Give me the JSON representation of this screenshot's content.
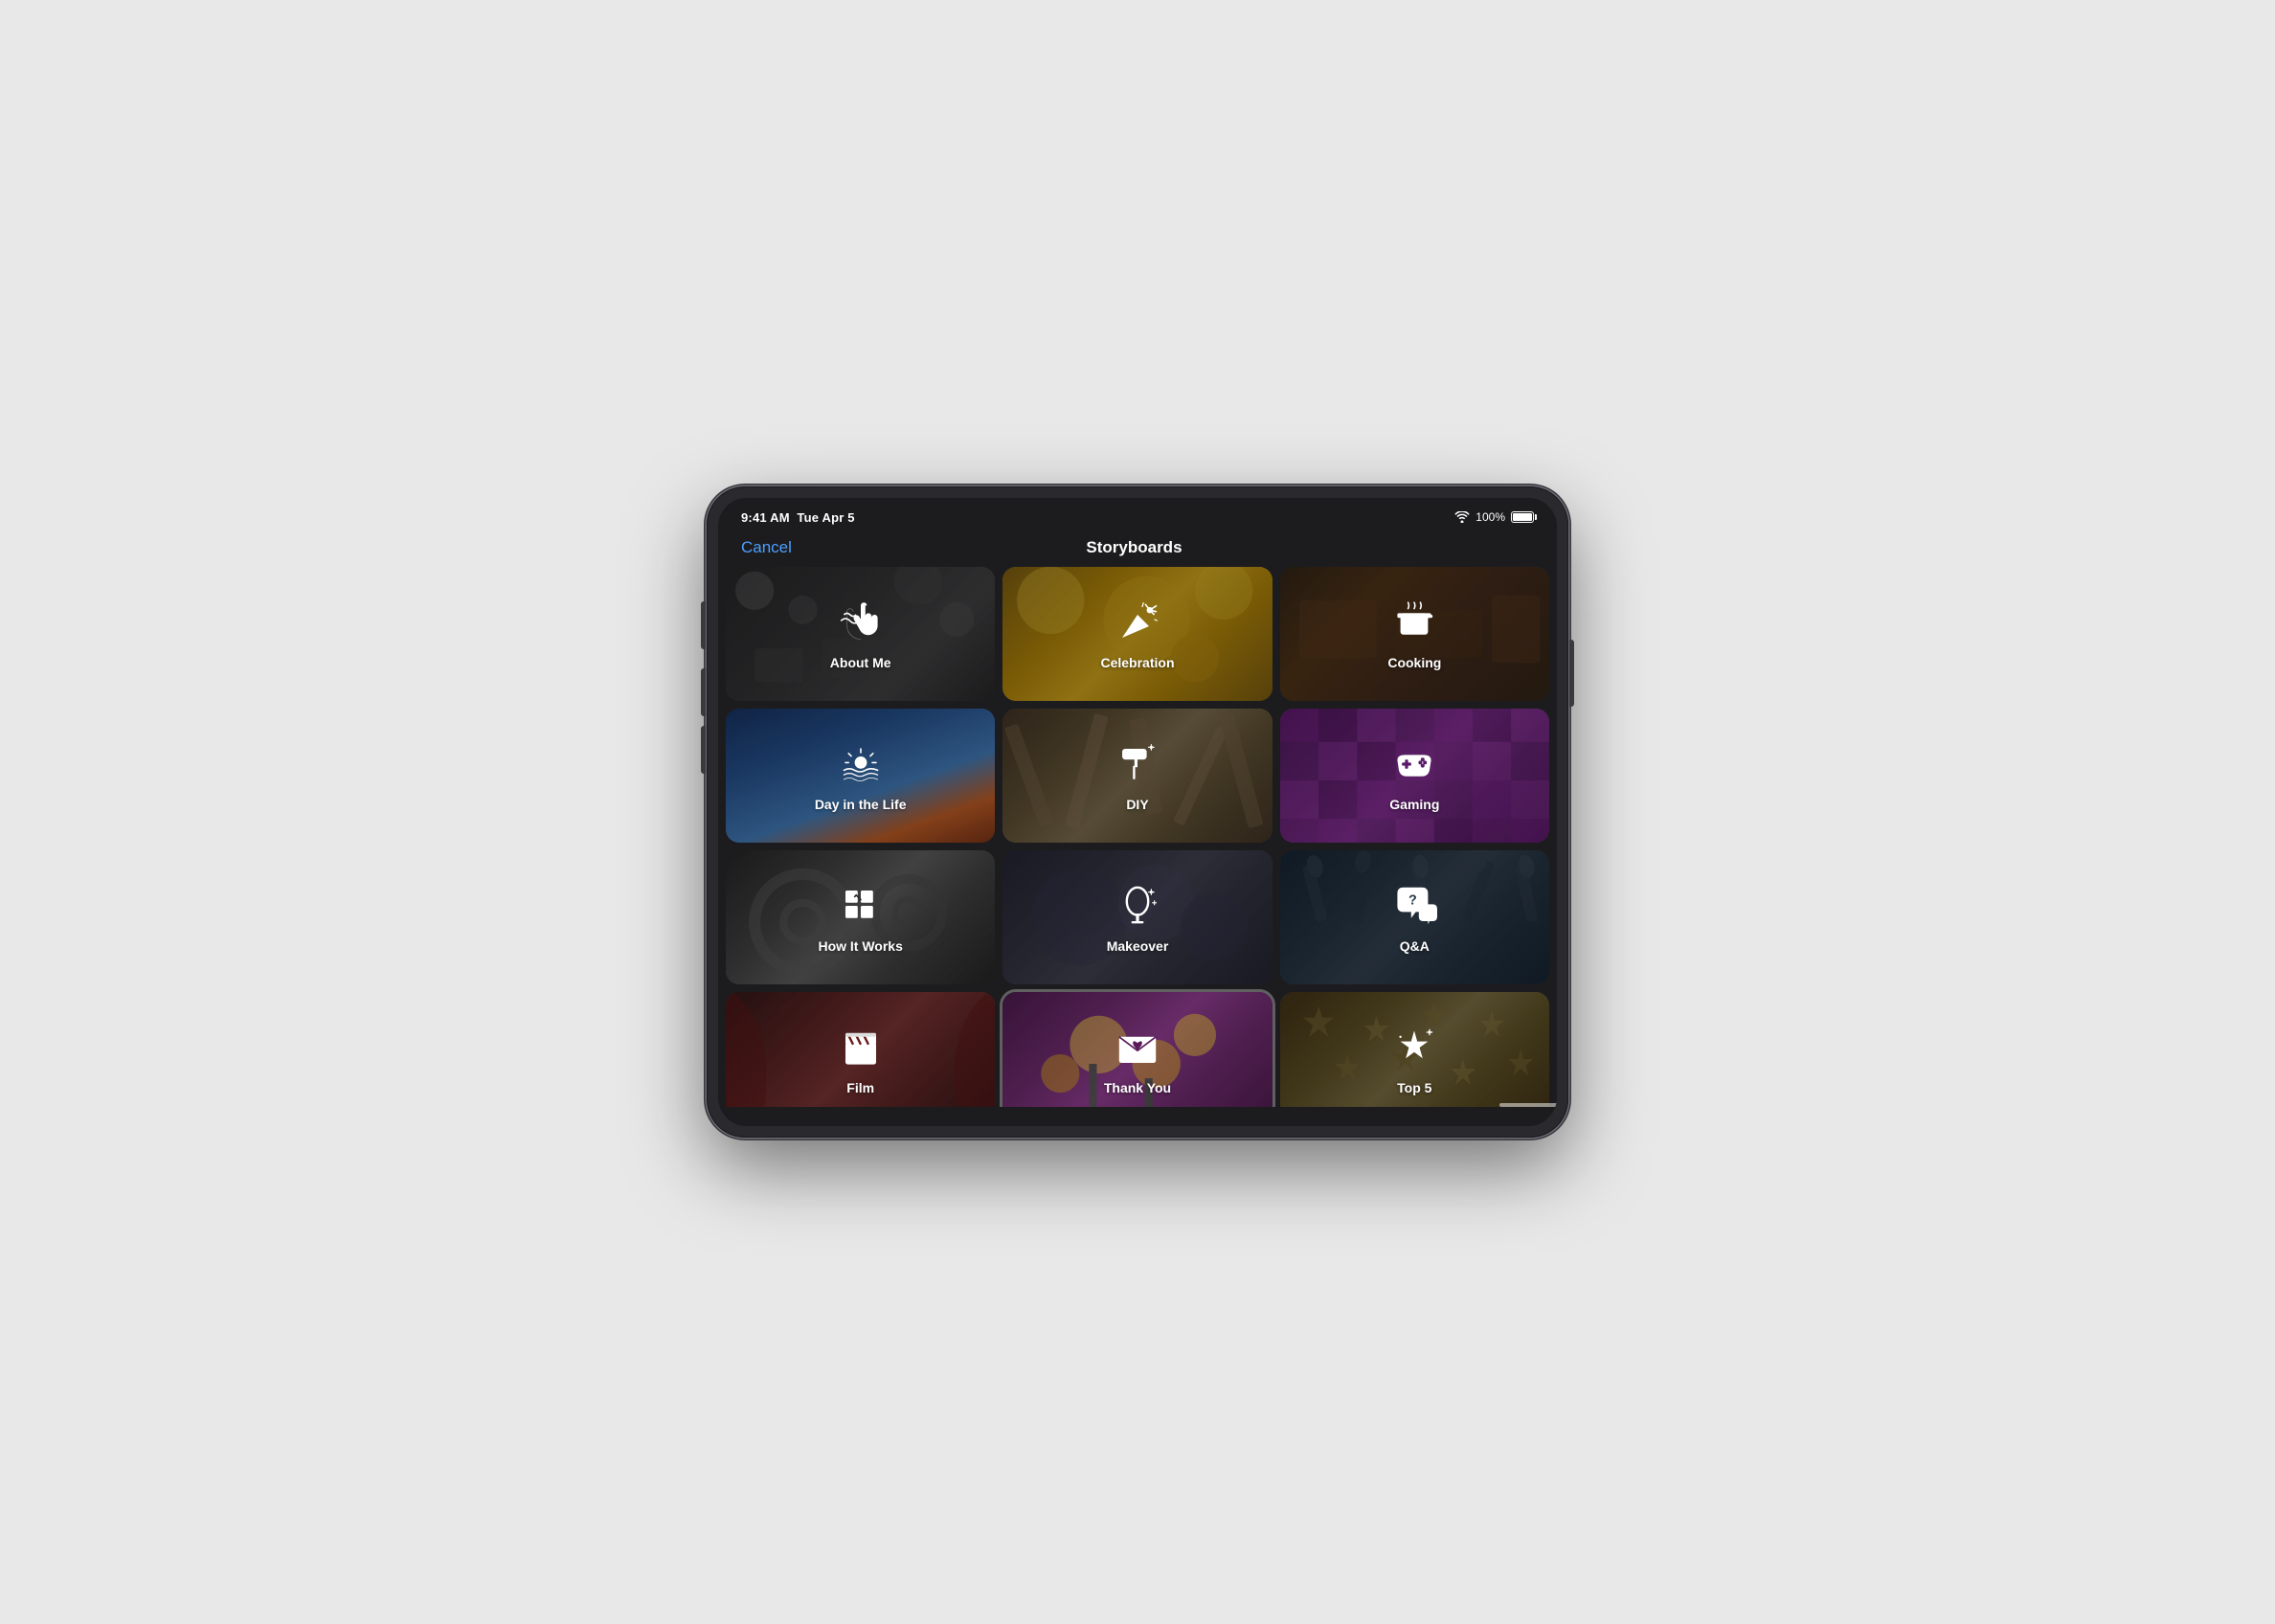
{
  "device": {
    "status_bar": {
      "time": "9:41 AM",
      "date": "Tue Apr 5",
      "wifi": "WiFi",
      "battery_pct": "100%"
    },
    "nav": {
      "cancel": "Cancel",
      "title": "Storyboards"
    }
  },
  "grid": {
    "items": [
      {
        "id": "about-me",
        "label": "About Me",
        "bg_class": "bg-about-me",
        "icon": "hand-wave"
      },
      {
        "id": "celebration",
        "label": "Celebration",
        "bg_class": "bg-celebration",
        "icon": "party-popper"
      },
      {
        "id": "cooking",
        "label": "Cooking",
        "bg_class": "bg-cooking",
        "icon": "cooking-pot"
      },
      {
        "id": "day-in-life",
        "label": "Day in the Life",
        "bg_class": "bg-day-in-life",
        "icon": "sunrise"
      },
      {
        "id": "diy",
        "label": "DIY",
        "bg_class": "bg-diy",
        "icon": "paint-roller"
      },
      {
        "id": "gaming",
        "label": "Gaming",
        "bg_class": "bg-gaming",
        "icon": "gamepad"
      },
      {
        "id": "how-it-works",
        "label": "How It Works",
        "bg_class": "bg-how-it-works",
        "icon": "gears"
      },
      {
        "id": "makeover",
        "label": "Makeover",
        "bg_class": "bg-makeover",
        "icon": "mirror"
      },
      {
        "id": "qa",
        "label": "Q&A",
        "bg_class": "bg-qa",
        "icon": "speech-bubble-question"
      },
      {
        "id": "film",
        "label": "Film",
        "bg_class": "bg-film",
        "icon": "film-clapper"
      },
      {
        "id": "thank-you",
        "label": "Thank You",
        "bg_class": "bg-thank-you",
        "icon": "envelope-heart",
        "selected": true
      },
      {
        "id": "top5",
        "label": "Top 5",
        "bg_class": "bg-top5",
        "icon": "star-sparkle"
      }
    ]
  }
}
